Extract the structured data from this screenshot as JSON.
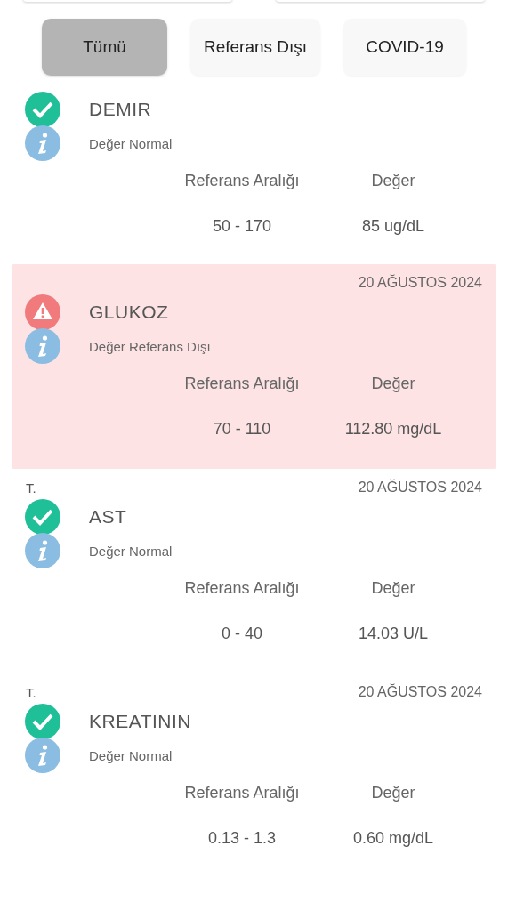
{
  "filters": [
    {
      "label": "Tümü",
      "selected": true
    },
    {
      "label": "Referans Dışı",
      "selected": false
    },
    {
      "label": "COVID-19",
      "selected": false
    }
  ],
  "results": [
    {
      "kind": "normal",
      "name": "DEMIR",
      "note": "Değer Normal",
      "range_label": "Referans Aralığı",
      "value_label": "Değer",
      "range": "50 - 170",
      "value": "85 ug/dL"
    },
    {
      "kind": "abnormal",
      "date": "20 AĞUSTOS 2024",
      "name": "GLUKOZ",
      "note": "Değer Referans Dışı",
      "range_label": "Referans Aralığı",
      "value_label": "Değer",
      "range": "70 - 110",
      "value": "112.80 mg/dL"
    },
    {
      "kind": "normal",
      "source": "T.",
      "date": "20 AĞUSTOS 2024",
      "name": "AST",
      "note": "Değer Normal",
      "range_label": "Referans Aralığı",
      "value_label": "Değer",
      "range": "0 - 40",
      "value": "14.03 U/L"
    },
    {
      "kind": "normal",
      "source": "T.",
      "date": "20 AĞUSTOS 2024",
      "name": "KREATININ",
      "note": "Değer Normal",
      "range_label": "Referans Aralığı",
      "value_label": "Değer",
      "range": "0.13 - 1.3",
      "value": "0.60 mg/dL"
    }
  ]
}
